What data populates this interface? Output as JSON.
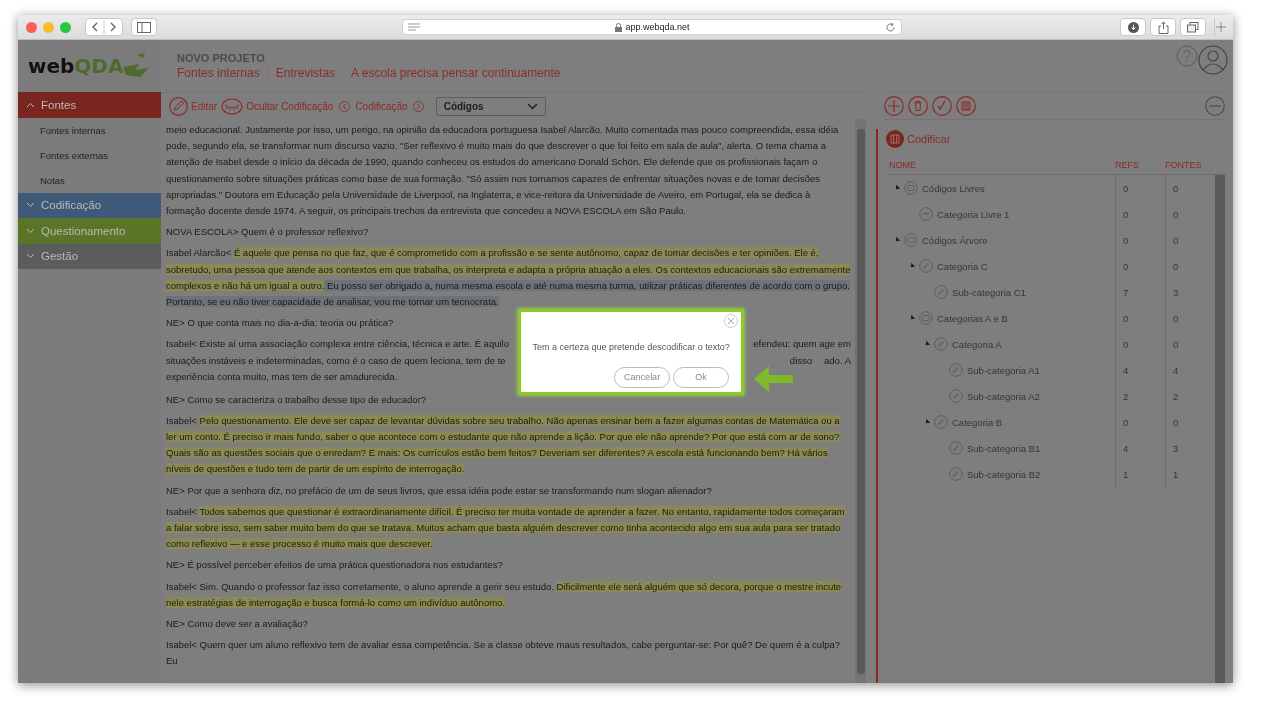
{
  "browser": {
    "url": "app.webqda.net"
  },
  "logo": {
    "start": "web",
    "end": "QDA"
  },
  "sidebar": {
    "sections": [
      {
        "label": "Fontes",
        "color": "#7a2620",
        "expanded": true,
        "items": [
          {
            "label": "Fontes internas",
            "selected": false
          },
          {
            "label": "Fontes externas",
            "selected": false
          },
          {
            "label": "Notas",
            "selected": false
          }
        ]
      },
      {
        "label": "Codificação",
        "color": "#3e5a78",
        "expanded": false
      },
      {
        "label": "Questionamento",
        "color": "#5a7428",
        "expanded": false
      },
      {
        "label": "Gestão",
        "color": "#5c5c5c",
        "expanded": false
      }
    ]
  },
  "header": {
    "project": "NOVO PROJETO",
    "breadcrumb": [
      "Fontes internas",
      "Entrevistas",
      "A escola precisa pensar continuamente"
    ]
  },
  "toolbar": {
    "edit": "Editar",
    "hide_coding": "Ocultar Codificação",
    "coding_nav": "Codificação",
    "dropdown": "Códigos"
  },
  "document": {
    "paragraphs": [
      {
        "kind": "text",
        "segments": [
          {
            "kind": "plain",
            "text": "meio educacional. Justamente por isso, um perigo, na opinião da educadora portuguesa Isabel Alarcão. Muito comentada mas pouco compreendida, essa idéia pode, segundo ela, se transformar num discurso vazio. \"Ser reflexivo é muito mais do que descrever o que foi feito em sala de aula\", alerta. O tema chama a atenção de Isabel desde o início da década de 1990, quando conheceu os estudos do americano Donald Schön. Ele defende que os profissionais façam o questionamento sobre situações práticas como base de sua formação. \"Só assim nos tornamos capazes de enfrentar situações novas e de tomar decisões apropriadas.\" Doutora em Educação pela Universidade de Liverpool, na Inglaterra, e vice-reitora da Universidade de Aveiro, em Portugal, ela se dedica à formação docente desde 1974. A seguir, os principais trechos da entrevista que concedeu a NOVA ESCOLA em São Paulo."
          }
        ]
      },
      {
        "kind": "text",
        "segments": [
          {
            "kind": "plain",
            "text": "NOVA ESCOLA> Quem é o professor reflexivo?"
          }
        ]
      },
      {
        "kind": "text",
        "segments": [
          {
            "kind": "plain",
            "text": "Isabel Alarcão< "
          },
          {
            "kind": "coded",
            "text": "É aquele que pensa no que faz, que é comprometido com a profissão e se sente autônomo, capaz de tomar decisões e ter opiniões. Ele é, sobretudo, uma pessoa que atende aos contextos em que trabalha, os interpreta e adapta a própria atuação a eles. Os contextos educacionais são extremamente complexos e não há um igual a outro."
          },
          {
            "kind": "selected",
            "text": " Eu posso ser obrigado a, numa mesma escola e até numa mesma turma, utilizar práticas diferentes de acordo com o grupo. Portanto, se eu não tiver capacidade de analisar, vou me tornar um tecnocrata."
          }
        ]
      },
      {
        "kind": "text",
        "segments": [
          {
            "kind": "plain",
            "text": "NE> O que conta mais no dia-a-dia: teoria ou prática?"
          }
        ]
      },
      {
        "kind": "covered",
        "lines": [
          [
            "Isabel< Existe aí uma associação complexa entre ciência, técnica e arte. É aquilo",
            "efendeu: quem age em"
          ],
          [
            "situações instáveis e indeterminadas, como é o caso de quem leciona, tem de te",
            "disso",
            "ado. A"
          ],
          [
            "experiência conta muito, mas tem de ser amadurecida."
          ]
        ]
      },
      {
        "kind": "text",
        "segments": [
          {
            "kind": "plain",
            "text": "NE> Como se caracteriza o trabalho desse tipo de educador?"
          }
        ]
      },
      {
        "kind": "text",
        "segments": [
          {
            "kind": "plain",
            "text": "Isabel< "
          },
          {
            "kind": "coded",
            "text": "Pelo questionamento. Ele deve ser capaz de levantar dúvidas sobre seu trabalho. Não apenas ensinar bem a fazer algumas contas de Matemática ou a ler um conto. É preciso ir mais fundo, saber o que acontece com o estudante que não aprende a lição. Por que ele não aprende? Por que está com ar de sono? Quais são as questões sociais que o enredam? E mais: Os currículos estão bem feitos? Deveriam ser diferentes? A escola está funcionando bem? Há vários níveis de questões e tudo tem de partir de um espírito de interrogação."
          }
        ]
      },
      {
        "kind": "text",
        "segments": [
          {
            "kind": "plain",
            "text": "NE> Por que a senhora diz, no prefácio de um de seus livros, que essa idéia pode estar se transformando num slogan alienador?"
          }
        ]
      },
      {
        "kind": "text",
        "segments": [
          {
            "kind": "plain",
            "text": "Isabel< "
          },
          {
            "kind": "coded",
            "text": "Todos sabemos que questionar é extraordinariamente difícil. É preciso ter muita vontade de aprender a fazer. No entanto, rapidamente todos começaram a falar sobre isso, sem saber muito bem do que se tratava. Muitos acham que basta alguém descrever como tinha acontecido algo em sua aula para ser tratado como reflexivo — e esse processo é muito mais que descrever."
          }
        ]
      },
      {
        "kind": "text",
        "segments": [
          {
            "kind": "plain",
            "text": "NE> É possível perceber efeitos de uma prática questionadora nos estudantes?"
          }
        ]
      },
      {
        "kind": "text",
        "segments": [
          {
            "kind": "plain",
            "text": "Isabel< Sim. Quando o professor faz isso corretamente, o aluno aprende a gerir seu estudo. "
          },
          {
            "kind": "coded",
            "text": "Dificilmente ele será alguém que só decora, porque o mestre incute nele estratégias de interrogação e busca formá-lo como um indivíduo autônomo."
          }
        ]
      },
      {
        "kind": "text",
        "segments": [
          {
            "kind": "plain",
            "text": "NE> Como deve ser a avaliação?"
          }
        ]
      },
      {
        "kind": "text",
        "segments": [
          {
            "kind": "plain",
            "text": "Isabel< Quem quer um aluno reflexivo tem de avaliar essa competência. Se a classe obteve maus resultados, cabe perguntar-se: Por quê? De quem é a culpa? Eu"
          }
        ]
      }
    ]
  },
  "dialog": {
    "message": "Tem a certeza que pretende descodificar o texto?",
    "buttons": [
      "Cancelar",
      "Ok"
    ]
  },
  "coding_panel": {
    "title": "Codificar",
    "columns": [
      "NOME",
      "REFS",
      "FONTES"
    ],
    "tree": [
      {
        "name": "Códigos Livres",
        "kind": "group",
        "refs": "0",
        "sources": "0",
        "expanded": true,
        "children": [
          {
            "name": "Categoria Livre 1",
            "kind": "free",
            "refs": "0",
            "sources": "0"
          }
        ]
      },
      {
        "name": "Códigos Árvore",
        "kind": "group",
        "refs": "0",
        "sources": "0",
        "expanded": true,
        "children": [
          {
            "name": "Categoria C",
            "kind": "category",
            "refs": "0",
            "sources": "0",
            "expanded": true,
            "children": [
              {
                "name": "Sub-categoria C1",
                "kind": "category",
                "refs": "7",
                "sources": "3"
              }
            ]
          },
          {
            "name": "Categorias A e B",
            "kind": "group",
            "refs": "0",
            "sources": "0",
            "expanded": true,
            "children": [
              {
                "name": "Categoria A",
                "kind": "category",
                "refs": "0",
                "sources": "0",
                "expanded": true,
                "children": [
                  {
                    "name": "Sub-categoria A1",
                    "kind": "category",
                    "refs": "4",
                    "sources": "4"
                  },
                  {
                    "name": "Sub-categoria A2",
                    "kind": "category",
                    "refs": "2",
                    "sources": "2"
                  }
                ]
              },
              {
                "name": "Categoria B",
                "kind": "category",
                "refs": "0",
                "sources": "0",
                "expanded": true,
                "children": [
                  {
                    "name": "Sub-categoria B1",
                    "kind": "category",
                    "refs": "4",
                    "sources": "3"
                  },
                  {
                    "name": "Sub-categoria B2",
                    "kind": "category",
                    "refs": "1",
                    "sources": "1"
                  }
                ]
              }
            ]
          }
        ]
      }
    ]
  }
}
